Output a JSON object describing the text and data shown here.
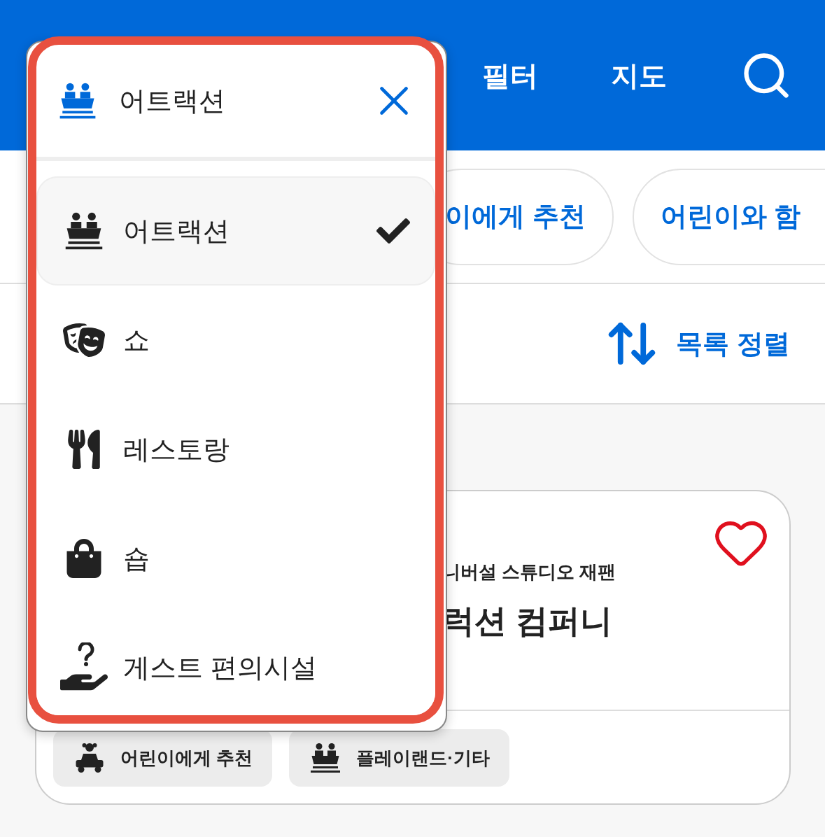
{
  "header": {
    "links": [
      "필터",
      "지도"
    ]
  },
  "chips": [
    {
      "label": "이에게 추천"
    },
    {
      "label": "어린이와 함"
    }
  ],
  "sort": {
    "label": "목록 정렬"
  },
  "card": {
    "park": "니버설 스튜디오 재팬",
    "title": "럭션 컴퍼니",
    "favorite": false,
    "tags": [
      {
        "label": "어린이에게 추천",
        "kind": "kids"
      },
      {
        "label": "플레이랜드·기타",
        "kind": "attraction"
      }
    ]
  },
  "dropdown": {
    "title": "어트랙션",
    "kind": "attraction",
    "items": [
      {
        "label": "어트랙션",
        "kind": "attraction",
        "selected": true
      },
      {
        "label": "쇼",
        "kind": "show",
        "selected": false
      },
      {
        "label": "레스토랑",
        "kind": "restaurant",
        "selected": false
      },
      {
        "label": "숍",
        "kind": "shop",
        "selected": false
      },
      {
        "label": "게스트 편의시설",
        "kind": "guest",
        "selected": false
      }
    ]
  }
}
